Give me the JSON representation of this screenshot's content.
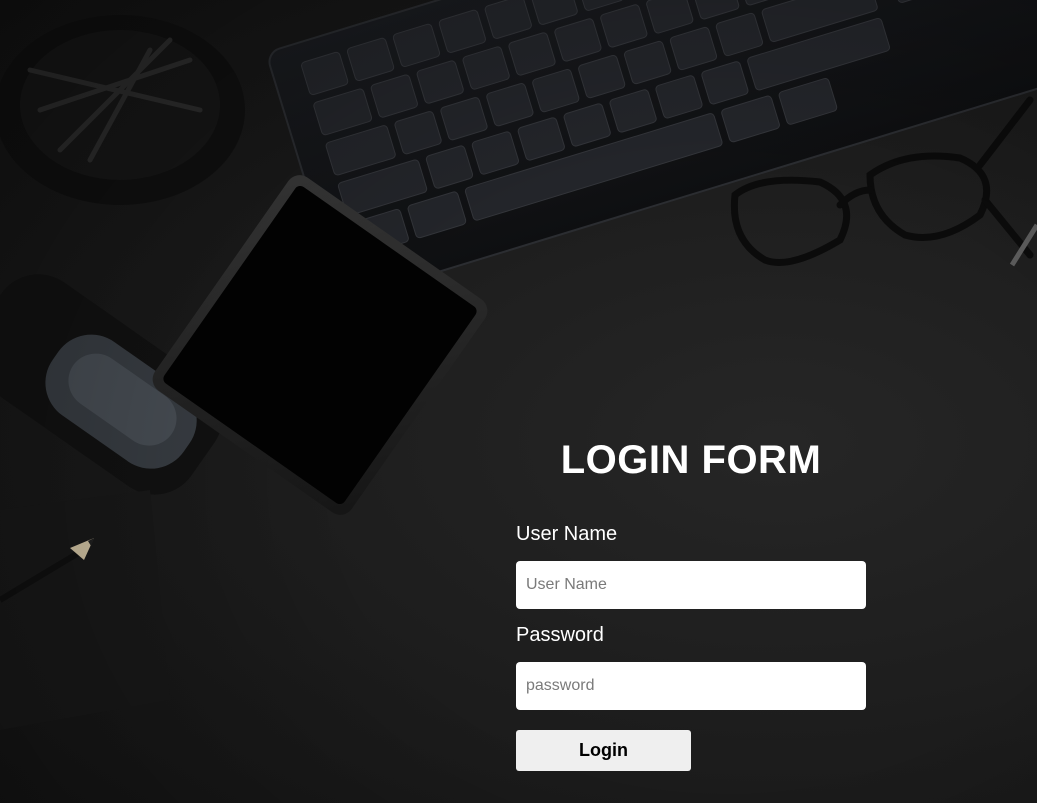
{
  "form": {
    "title": "LOGIN FORM",
    "username_label": "User Name",
    "username_placeholder": "User Name",
    "username_value": "",
    "password_label": "Password",
    "password_placeholder": "password",
    "password_value": "",
    "login_label": "Login"
  },
  "background": {
    "objects": [
      "keyboard",
      "smartphone",
      "eyeglasses",
      "pencil",
      "pen-holder",
      "stapler"
    ]
  },
  "colors": {
    "background": "#1f1f1f",
    "title_text": "#ffffff",
    "input_bg": "#ffffff",
    "button_bg": "#efefef",
    "button_text": "#000000"
  }
}
